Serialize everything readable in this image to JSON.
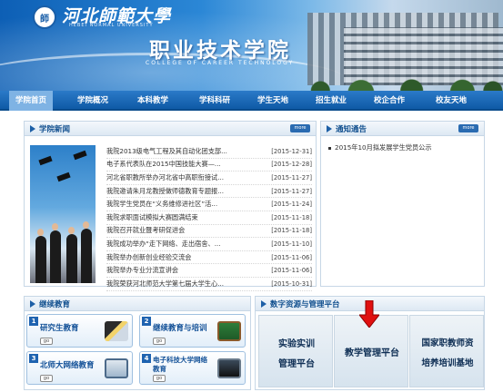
{
  "header": {
    "logo_cn": "河北師範大學",
    "logo_en": "HEBEI NORMAL UNIVERSITY",
    "college_cn": "职业技术学院",
    "college_en": "COLLEGE OF CAREER TECHNOLOGY"
  },
  "nav": [
    {
      "label": "学院首页",
      "active": true
    },
    {
      "label": "学院概况"
    },
    {
      "label": "本科教学"
    },
    {
      "label": "学科科研"
    },
    {
      "label": "学生天地"
    },
    {
      "label": "招生就业"
    },
    {
      "label": "校企合作"
    },
    {
      "label": "校友天地"
    }
  ],
  "news": {
    "title": "学院新闻",
    "more": "more",
    "items": [
      {
        "title": "我院2013级电气工程及其自动化团支部...",
        "date": "[2015-12-31]"
      },
      {
        "title": "电子系代表队在2015中国技能大赛—...",
        "date": "[2015-12-28]"
      },
      {
        "title": "河北省职教所举办河北省中高职衔接试...",
        "date": "[2015-11-27]"
      },
      {
        "title": "我院邀请朱月龙教授做师德教育专题报...",
        "date": "[2015-11-27]"
      },
      {
        "title": "我院学生党员在“义务维修进社区”活...",
        "date": "[2015-11-24]"
      },
      {
        "title": "我院求职面试模拟大赛圆满结束",
        "date": "[2015-11-18]"
      },
      {
        "title": "我院召开就业暨考研促进会",
        "date": "[2015-11-18]"
      },
      {
        "title": "我院成功举办“走下网络、走出宿舍、...",
        "date": "[2015-11-10]"
      },
      {
        "title": "我院举办创新创业经验交流会",
        "date": "[2015-11-06]"
      },
      {
        "title": "我院举办专业分流宣讲会",
        "date": "[2015-11-06]"
      },
      {
        "title": "我院荣获河北师范大学第七届大学生心...",
        "date": "[2015-10-31]"
      }
    ]
  },
  "notice": {
    "title": "通知通告",
    "more": "more",
    "items": [
      {
        "title": "2015年10月拟发展学生党员公示"
      }
    ]
  },
  "continuing_education": {
    "title": "继续教育",
    "cards": [
      {
        "num": "1",
        "label": "研究生教育",
        "go": "go"
      },
      {
        "num": "2",
        "label": "继续教育与培训",
        "go": "go"
      },
      {
        "num": "3",
        "label": "北师大网络教育",
        "go": "go"
      },
      {
        "num": "4",
        "label": "电子科技大学网络教育",
        "go": "go"
      }
    ]
  },
  "digital_resources": {
    "title": "数字资源与管理平台",
    "tiles": [
      {
        "line1": "实验实训",
        "line2": "管理平台"
      },
      {
        "line1": "教学管理平台",
        "line2": ""
      },
      {
        "line1": "国家职教师资",
        "line2": "培养培训基地"
      }
    ]
  },
  "colors": {
    "brand_blue": "#0f5aa6",
    "accent_red": "#e01010",
    "panel_title": "#12508f"
  }
}
